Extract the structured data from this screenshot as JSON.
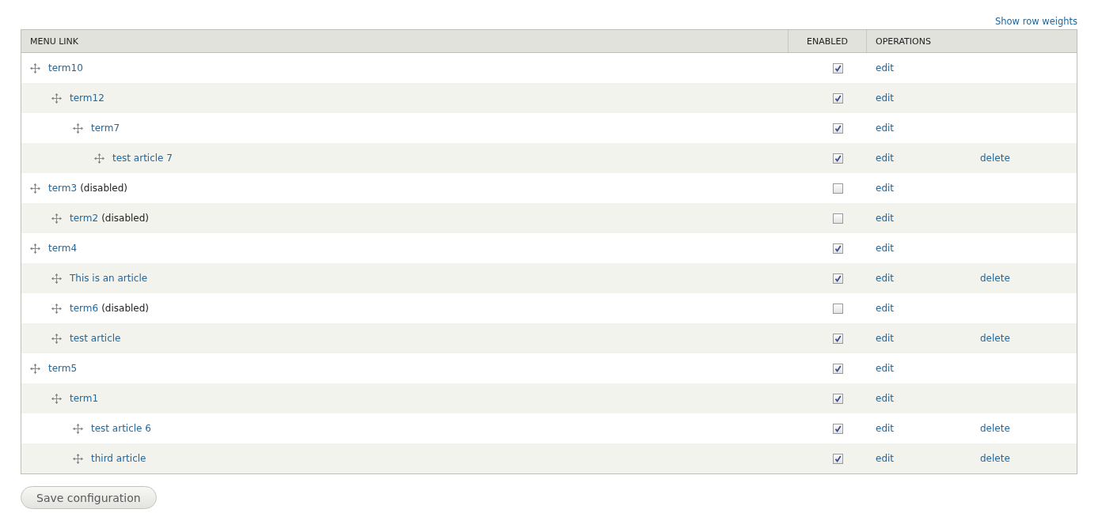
{
  "top_link": "Show row weights",
  "table": {
    "columns": [
      "MENU LINK",
      "ENABLED",
      "OPERATIONS"
    ],
    "rows": [
      {
        "title": "term10",
        "enabled": true,
        "operations": [
          "edit"
        ],
        "children": [
          {
            "title": "term12",
            "enabled": true,
            "operations": [
              "edit"
            ],
            "children": [
              {
                "title": "term7",
                "enabled": true,
                "operations": [
                  "edit"
                ],
                "children": [
                  {
                    "title": "test article 7",
                    "enabled": true,
                    "operations": [
                      "edit",
                      "delete"
                    ]
                  }
                ]
              }
            ]
          }
        ]
      },
      {
        "title": "term3",
        "status": "(disabled)",
        "enabled": false,
        "operations": [
          "edit"
        ],
        "children": [
          {
            "title": "term2",
            "status": "(disabled)",
            "enabled": false,
            "operations": [
              "edit"
            ]
          }
        ]
      },
      {
        "title": "term4",
        "enabled": true,
        "operations": [
          "edit"
        ],
        "children": [
          {
            "title": "This is an article",
            "enabled": true,
            "operations": [
              "edit",
              "delete"
            ]
          },
          {
            "title": "term6",
            "status": "(disabled)",
            "enabled": false,
            "operations": [
              "edit"
            ]
          },
          {
            "title": "test article",
            "enabled": true,
            "operations": [
              "edit",
              "delete"
            ]
          }
        ]
      },
      {
        "title": "term5",
        "enabled": true,
        "operations": [
          "edit"
        ],
        "children": [
          {
            "title": "term1",
            "enabled": true,
            "operations": [
              "edit"
            ],
            "children": [
              {
                "title": "test article 6",
                "enabled": true,
                "operations": [
                  "edit",
                  "delete"
                ]
              },
              {
                "title": "third article",
                "enabled": true,
                "operations": [
                  "edit",
                  "delete"
                ]
              }
            ]
          }
        ]
      }
    ]
  },
  "buttons": [
    {
      "label": "Save configuration"
    }
  ]
}
